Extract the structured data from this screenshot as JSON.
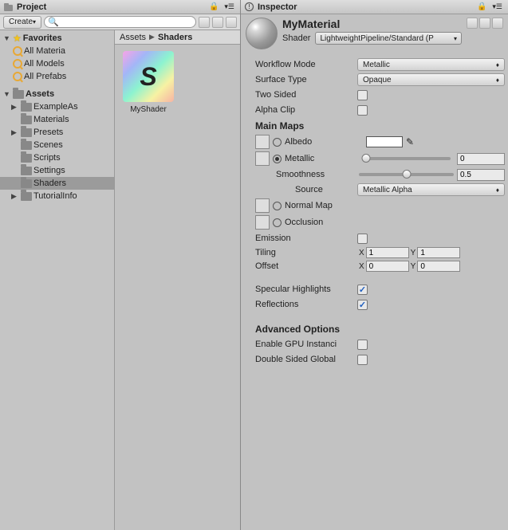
{
  "project": {
    "title": "Project",
    "create_label": "Create",
    "search_placeholder": "",
    "favorites_label": "Favorites",
    "fav_items": [
      "All Materia",
      "All Models",
      "All Prefabs"
    ],
    "assets_label": "Assets",
    "folders": [
      "ExampleAs",
      "Materials",
      "Presets",
      "Scenes",
      "Scripts",
      "Settings",
      "Shaders",
      "TutorialInfo"
    ],
    "breadcrumb": [
      "Assets",
      "Shaders"
    ],
    "grid_item": {
      "label": "MyShader",
      "glyph": "S"
    }
  },
  "inspector": {
    "title": "Inspector",
    "material_name": "MyMaterial",
    "shader_label": "Shader",
    "shader_value": "LightweightPipeline/Standard (P",
    "workflow_mode": {
      "label": "Workflow Mode",
      "value": "Metallic"
    },
    "surface_type": {
      "label": "Surface Type",
      "value": "Opaque"
    },
    "two_sided": {
      "label": "Two Sided"
    },
    "alpha_clip": {
      "label": "Alpha Clip"
    },
    "main_maps": "Main Maps",
    "albedo": "Albedo",
    "metallic_label": "Metallic",
    "metallic_value": "0",
    "smoothness_label": "Smoothness",
    "smoothness_value": "0.5",
    "source_label": "Source",
    "source_value": "Metallic Alpha",
    "normal_map": "Normal Map",
    "occlusion": "Occlusion",
    "emission": "Emission",
    "tiling_label": "Tiling",
    "tiling_x": "1",
    "tiling_y": "1",
    "offset_label": "Offset",
    "offset_x": "0",
    "offset_y": "0",
    "specular_highlights": "Specular Highlights",
    "reflections": "Reflections",
    "advanced_options": "Advanced Options",
    "gpu_instancing": "Enable GPU Instanci",
    "double_sided_global": "Double Sided Global",
    "xlabel": "X",
    "ylabel": "Y"
  }
}
